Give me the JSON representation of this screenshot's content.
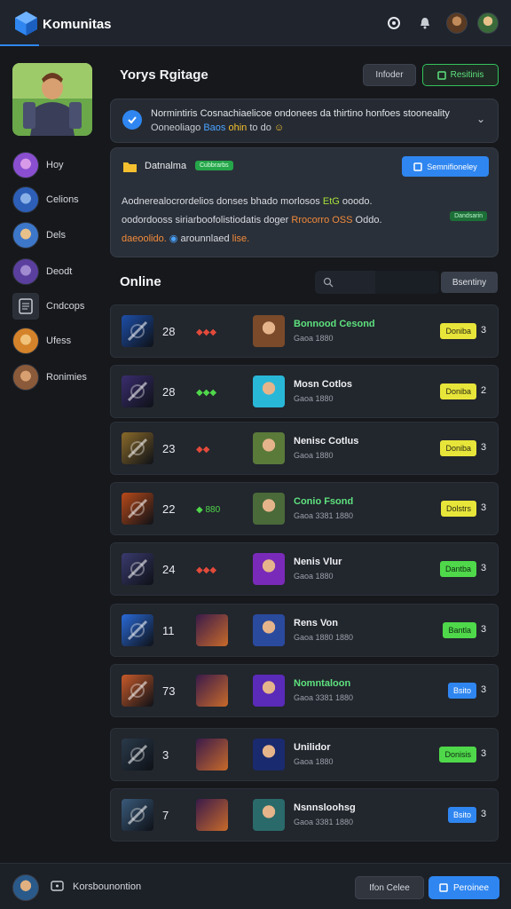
{
  "colors": {
    "accent": "#2f86f0",
    "green": "#35c25a",
    "yellow": "#e8e53a",
    "background": "#16181c",
    "card": "#22262d"
  },
  "topbar": {
    "brand": "Komunitas",
    "icons": [
      "settings-icon",
      "bell-icon",
      "avatar",
      "avatar"
    ]
  },
  "header": {
    "title": "Yorys Rgitage",
    "ghost_button": "Infoder",
    "green_button": "Resitinis"
  },
  "notice": {
    "line1": "Normintiris Cosnachiaelicoe ondonees da thirtino honfoes stooneality",
    "line2_prefix": "Ooneoliago",
    "line2_hl1": "Baos",
    "line2_hl2": "ohin",
    "line2_suffix": "to do"
  },
  "panel": {
    "title": "Datnalma",
    "badge": "Cubbrarbs",
    "button": "Semnifioneley",
    "line1_text": "Aodnerealocrordelios donses bhado morlosos",
    "line1_hl": "EtG",
    "line1_end": "ooodo.",
    "line2_text": "oodordooss siriarboofolistiodatis doger",
    "line2_hl": "Rrocorro OSS",
    "line2_end": "Oddo.",
    "line3_hl": "daeoolido.",
    "line3_text": "arounnlaed",
    "line3_end": "lise.",
    "pill": "Dandsarin"
  },
  "online": {
    "title": "Online",
    "filter": "Bsentiny"
  },
  "sidebar": {
    "items": [
      {
        "label": "Hoy",
        "color": "#8a4fd0"
      },
      {
        "label": "Celions",
        "color": "#2d5fb8"
      },
      {
        "label": "Dels",
        "color": "#3d77c9"
      },
      {
        "label": "Deodt",
        "color": "#5b3f9e"
      },
      {
        "label": "Cndcops",
        "color": "#3a4150"
      },
      {
        "label": "Ufess",
        "color": "#d4832a"
      },
      {
        "label": "Ronimies",
        "color": "#8a5a3a"
      }
    ]
  },
  "rows": [
    {
      "level": "28",
      "gems": "◆◆◆",
      "name": "Bonnood Cesond",
      "sub": "Gaoa 1880",
      "name_color": "#5ee27e",
      "badge": "Doniba",
      "badge_bg": "#e8e53a",
      "badge_fg": "#2a2a10",
      "count": "3",
      "thumb": "#1d4ea8",
      "avatar": "#7a4a2a"
    },
    {
      "level": "28",
      "gems": "◆◆◆",
      "name": "Mosn Cotlos",
      "sub": "Gaoa 1880",
      "name_color": "#eef0f3",
      "badge": "Doniba",
      "badge_bg": "#e8e53a",
      "badge_fg": "#2a2a10",
      "count": "2",
      "thumb": "#3a2d6e",
      "avatar": "#29b7d8"
    },
    {
      "level": "23",
      "gems": "◆◆",
      "name": "Nenisc Cotlus",
      "sub": "Gaoa 1880",
      "name_color": "#eef0f3",
      "badge": "Doniba",
      "badge_bg": "#e8e53a",
      "badge_fg": "#2a2a10",
      "count": "3",
      "thumb": "#8a6a2a",
      "avatar": "#5a7a3a"
    },
    {
      "level": "22",
      "gems": "◆ 880",
      "name": "Conio Fsond",
      "sub": "Gaoa 3381 1880",
      "name_color": "#5ee27e",
      "badge": "Dolstrs",
      "badge_bg": "#e8e53a",
      "badge_fg": "#2a2a10",
      "count": "3",
      "thumb": "#b84a1a",
      "avatar": "#4a6a3a"
    },
    {
      "level": "24",
      "gems": "◆◆◆",
      "name": "Nenis Vlur",
      "sub": "Gaoa 1880",
      "name_color": "#eef0f3",
      "badge": "Dantba",
      "badge_bg": "#4fd84a",
      "badge_fg": "#0f2a12",
      "count": "3",
      "thumb": "#3a3a6e",
      "avatar": "#7a2ab8"
    },
    {
      "level": "11",
      "gems": "",
      "name": "Rens Von",
      "sub": "Gaoa 1880 1880",
      "name_color": "#eef0f3",
      "badge": "Bantla",
      "badge_bg": "#4fd84a",
      "badge_fg": "#0f2a12",
      "count": "3",
      "thumb": "#2a6ad8",
      "avatar": "#2a4a9e"
    },
    {
      "level": "73",
      "gems": "",
      "name": "Nomntaloon",
      "sub": "Gaoa 3381 1880",
      "name_color": "#5ee27e",
      "badge": "Bsito",
      "badge_bg": "#2f86f0",
      "badge_fg": "#ffffff",
      "count": "3",
      "thumb": "#c85a2a",
      "avatar": "#5a2ab8"
    },
    {
      "level": "3",
      "gems": "",
      "name": "Unilidor",
      "sub": "Gaoa 1880",
      "name_color": "#eef0f3",
      "badge": "Donisis",
      "badge_bg": "#4fd84a",
      "badge_fg": "#0f2a12",
      "count": "3",
      "thumb": "#2a3a4a",
      "avatar": "#1a2a6e"
    },
    {
      "level": "7",
      "gems": "",
      "name": "Nsnnsloohsg",
      "sub": "Gaoa 3381 1880",
      "name_color": "#eef0f3",
      "badge": "Bsito",
      "badge_bg": "#2f86f0",
      "badge_fg": "#ffffff",
      "count": "3",
      "thumb": "#3a5a7a",
      "avatar": "#2a6a6a"
    }
  ],
  "bottombar": {
    "label": "Korsbounontion",
    "ghost_button": "Ifon Celee",
    "primary_button": "Peroinee"
  }
}
